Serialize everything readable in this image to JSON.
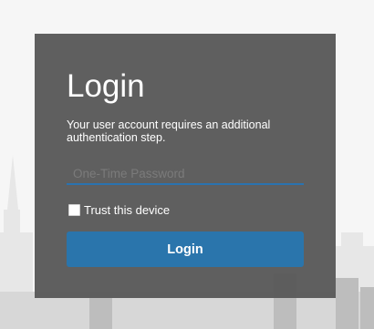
{
  "login": {
    "title": "Login",
    "description": "Your user account requires an additional authentication step.",
    "otp_placeholder": "One-Time Password",
    "otp_value": "",
    "trust_device_label": "Trust this device",
    "trust_device_checked": false,
    "submit_label": "Login"
  },
  "colors": {
    "background": "#f6f6f6",
    "card_background": "#585858",
    "accent": "#2a75ac",
    "text": "#ffffff"
  }
}
